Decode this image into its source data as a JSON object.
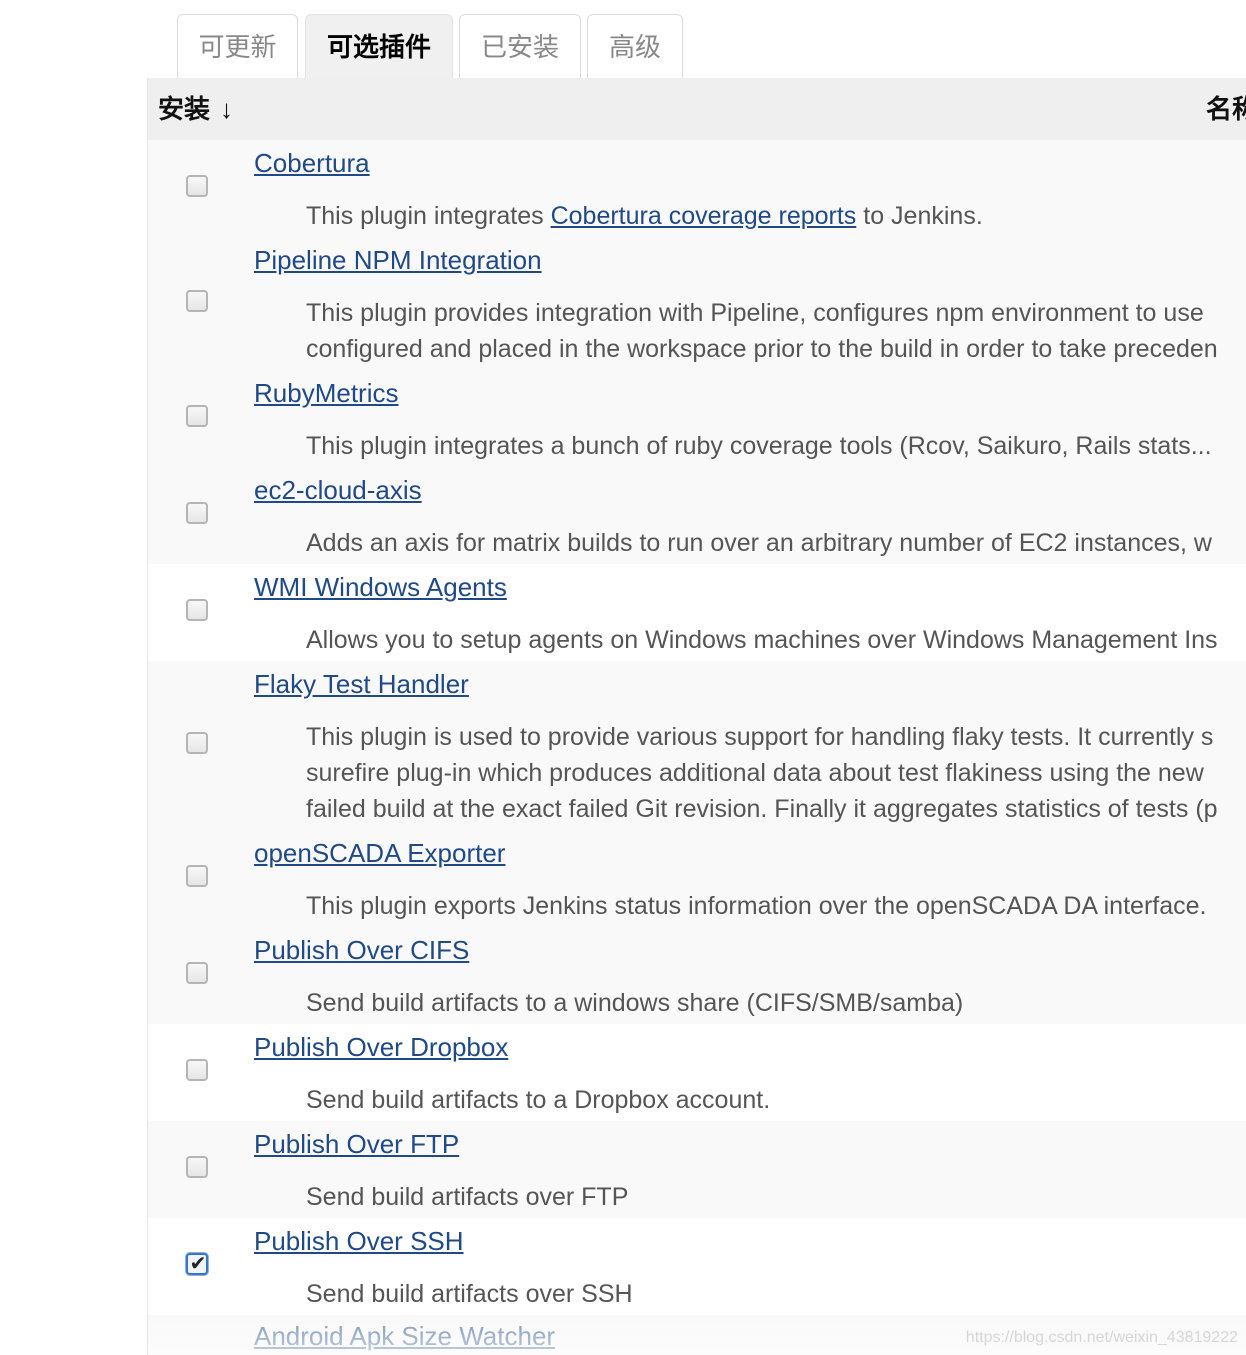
{
  "tabs": [
    {
      "label": "可更新",
      "active": false
    },
    {
      "label": "可选插件",
      "active": true
    },
    {
      "label": "已安装",
      "active": false
    },
    {
      "label": "高级",
      "active": false
    }
  ],
  "table": {
    "header": {
      "install": "安装",
      "sort_arrow": "↓",
      "name": "名称"
    }
  },
  "plugins": [
    {
      "name": "Cobertura",
      "checked": false,
      "desc_prefix": "This plugin integrates ",
      "desc_link": "Cobertura coverage reports",
      "desc_suffix": " to Jenkins."
    },
    {
      "name": "Pipeline NPM Integration",
      "checked": false,
      "desc_lines": [
        "This plugin provides integration with Pipeline, configures npm environment to use",
        "configured and placed in the workspace prior to the build in order to take preceden"
      ]
    },
    {
      "name": "RubyMetrics",
      "checked": false,
      "desc_lines": [
        "This plugin integrates a bunch of ruby coverage tools (Rcov, Saikuro, Rails stats..."
      ]
    },
    {
      "name": "ec2-cloud-axis",
      "checked": false,
      "desc_lines": [
        "Adds an axis for matrix builds to run over an arbitrary number of EC2 instances, w"
      ]
    },
    {
      "name": "WMI Windows Agents",
      "checked": false,
      "desc_lines": [
        "Allows you to setup agents on Windows machines over Windows Management Ins"
      ]
    },
    {
      "name": "Flaky Test Handler",
      "checked": false,
      "desc_lines": [
        "This plugin is used to provide various support for handling flaky tests. It currently s",
        "surefire plug-in which produces additional data about test flakiness using the new",
        "failed build at the exact failed Git revision. Finally it aggregates statistics of tests (p"
      ]
    },
    {
      "name": "openSCADA Exporter",
      "checked": false,
      "desc_lines": [
        "This plugin exports Jenkins status information over the openSCADA DA interface."
      ]
    },
    {
      "name": "Publish Over CIFS",
      "checked": false,
      "desc_lines": [
        "Send build artifacts to a windows share (CIFS/SMB/samba)"
      ]
    },
    {
      "name": "Publish Over Dropbox",
      "checked": false,
      "desc_lines": [
        "Send build artifacts to a Dropbox account."
      ]
    },
    {
      "name": "Publish Over FTP",
      "checked": false,
      "desc_lines": [
        "Send build artifacts over FTP"
      ]
    },
    {
      "name": "Publish Over SSH",
      "checked": true,
      "desc_lines": [
        "Send build artifacts over SSH"
      ]
    },
    {
      "name": "Android Apk Size Watcher",
      "checked": false,
      "desc_lines": []
    }
  ],
  "watermark": "https://blog.csdn.net/weixin_43819222",
  "colors": {
    "link": "#204a87",
    "header_bg": "#efefef",
    "row_alt_bg": "#f9f9f9",
    "checked_border": "#3a76c6"
  }
}
